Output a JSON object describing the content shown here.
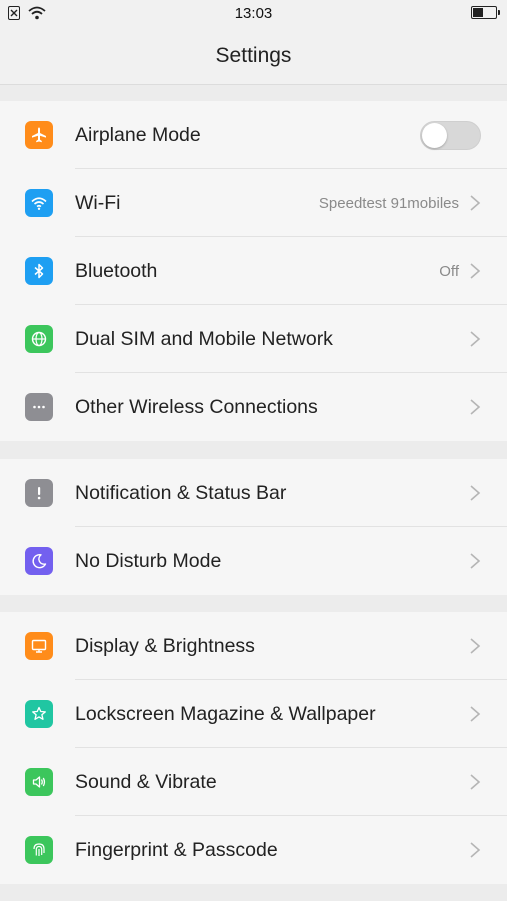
{
  "status_bar": {
    "time": "13:03",
    "icons": [
      "sim-off-icon",
      "wifi-icon",
      "battery-icon"
    ],
    "battery_level": 0.4
  },
  "header": {
    "title": "Settings"
  },
  "groups": [
    {
      "items": [
        {
          "label": "Airplane Mode",
          "icon": "airplane-icon",
          "color": "#ff8c1a",
          "control": "toggle",
          "toggle_on": false
        },
        {
          "label": "Wi-Fi",
          "icon": "wifi-icon",
          "color": "#1e9ff2",
          "value": "Speedtest 91mobiles"
        },
        {
          "label": "Bluetooth",
          "icon": "bluetooth-icon",
          "color": "#1e9ff2",
          "value": "Off"
        },
        {
          "label": "Dual SIM and Mobile Network",
          "icon": "globe-icon",
          "color": "#3cc65c"
        },
        {
          "label": "Other Wireless Connections",
          "icon": "more-icon",
          "color": "#8e8e93"
        }
      ]
    },
    {
      "items": [
        {
          "label": "Notification & Status Bar",
          "icon": "exclamation-icon",
          "color": "#8e8e93"
        },
        {
          "label": "No Disturb Mode",
          "icon": "moon-icon",
          "color": "#7360ef"
        }
      ]
    },
    {
      "items": [
        {
          "label": "Display & Brightness",
          "icon": "monitor-icon",
          "color": "#ff8c1a"
        },
        {
          "label": "Lockscreen Magazine & Wallpaper",
          "icon": "flower-icon",
          "color": "#20c6a2"
        },
        {
          "label": "Sound & Vibrate",
          "icon": "speaker-icon",
          "color": "#3cc65c"
        },
        {
          "label": "Fingerprint & Passcode",
          "icon": "fingerprint-icon",
          "color": "#3cc65c"
        }
      ]
    }
  ]
}
